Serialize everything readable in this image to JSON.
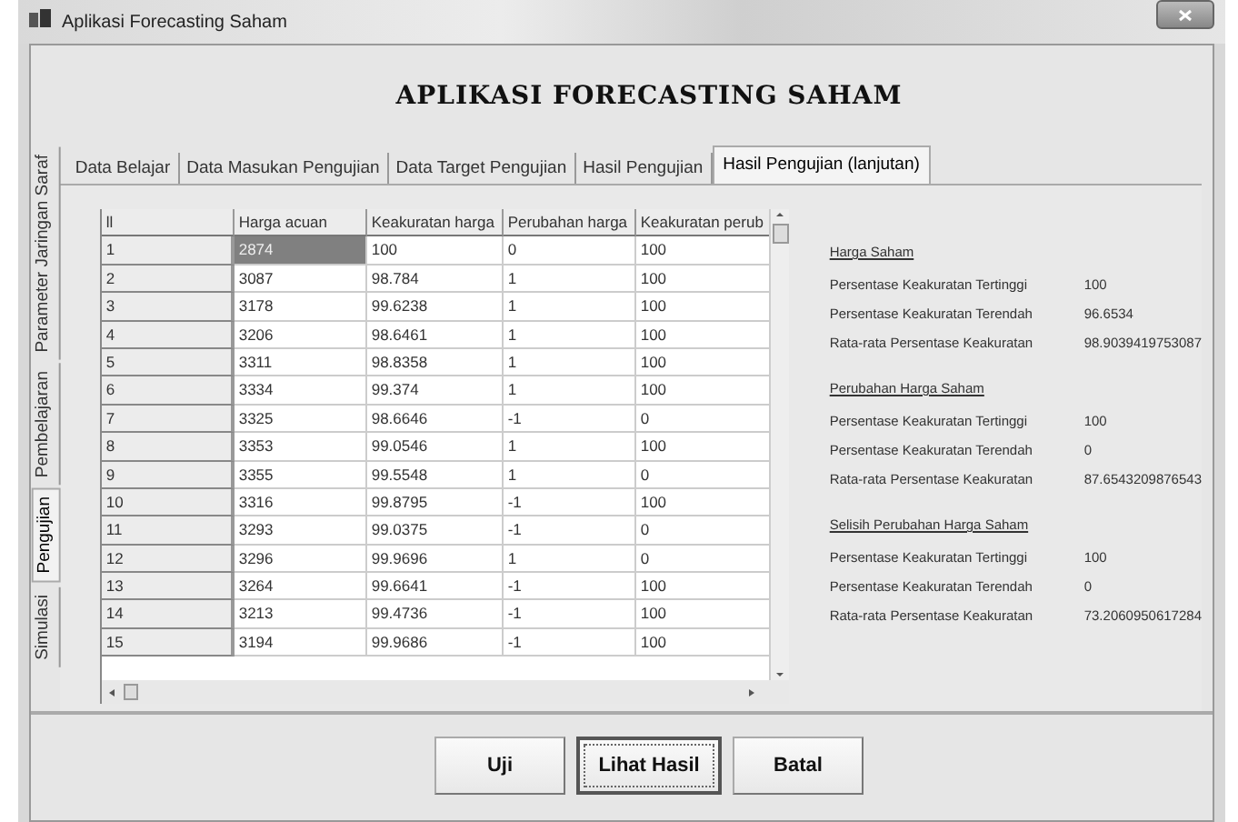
{
  "window": {
    "title": "Aplikasi Forecasting Saham"
  },
  "header": {
    "title": "APLIKASI FORECASTING SAHAM"
  },
  "side_tabs": [
    {
      "label": "Parameter Jaringan Saraf",
      "selected": false
    },
    {
      "label": "Pembelajaran",
      "selected": false
    },
    {
      "label": "Pengujian",
      "selected": true
    },
    {
      "label": "Simulasi",
      "selected": false
    }
  ],
  "tabs": [
    {
      "label": "Data Belajar",
      "selected": false
    },
    {
      "label": "Data Masukan Pengujian",
      "selected": false
    },
    {
      "label": "Data Target Pengujian",
      "selected": false
    },
    {
      "label": "Hasil Pengujian",
      "selected": false
    },
    {
      "label": "Hasil Pengujian (lanjutan)",
      "selected": true
    }
  ],
  "table": {
    "columns": [
      "ll",
      "Harga acuan",
      "Keakuratan harga",
      "Perubahan harga",
      "Keakuratan perub"
    ],
    "rows": [
      {
        "cells": [
          "1",
          "2874",
          "100",
          "0",
          "100"
        ],
        "selected": true
      },
      {
        "cells": [
          "2",
          "3087",
          "98.784",
          "1",
          "100"
        ],
        "selected": false
      },
      {
        "cells": [
          "3",
          "3178",
          "99.6238",
          "1",
          "100"
        ],
        "selected": false
      },
      {
        "cells": [
          "4",
          "3206",
          "98.6461",
          "1",
          "100"
        ],
        "selected": false
      },
      {
        "cells": [
          "5",
          "3311",
          "98.8358",
          "1",
          "100"
        ],
        "selected": false
      },
      {
        "cells": [
          "6",
          "3334",
          "99.374",
          "1",
          "100"
        ],
        "selected": false
      },
      {
        "cells": [
          "7",
          "3325",
          "98.6646",
          "-1",
          "0"
        ],
        "selected": false
      },
      {
        "cells": [
          "8",
          "3353",
          "99.0546",
          "1",
          "100"
        ],
        "selected": false
      },
      {
        "cells": [
          "9",
          "3355",
          "99.5548",
          "1",
          "0"
        ],
        "selected": false
      },
      {
        "cells": [
          "10",
          "3316",
          "99.8795",
          "-1",
          "100"
        ],
        "selected": false
      },
      {
        "cells": [
          "11",
          "3293",
          "99.0375",
          "-1",
          "0"
        ],
        "selected": false
      },
      {
        "cells": [
          "12",
          "3296",
          "99.9696",
          "1",
          "0"
        ],
        "selected": false
      },
      {
        "cells": [
          "13",
          "3264",
          "99.6641",
          "-1",
          "100"
        ],
        "selected": false
      },
      {
        "cells": [
          "14",
          "3213",
          "99.4736",
          "-1",
          "100"
        ],
        "selected": false
      },
      {
        "cells": [
          "15",
          "3194",
          "99.9686",
          "-1",
          "100"
        ],
        "selected": false
      }
    ]
  },
  "summary": [
    {
      "title": "Harga Saham",
      "rows": [
        {
          "label": "Persentase Keakuratan Tertinggi",
          "value": "100"
        },
        {
          "label": "Persentase Keakuratan Terendah",
          "value": "96.6534"
        },
        {
          "label": "Rata-rata Persentase Keakuratan",
          "value": "98.9039419753087"
        }
      ]
    },
    {
      "title": "Perubahan Harga Saham",
      "rows": [
        {
          "label": "Persentase Keakuratan Tertinggi",
          "value": "100"
        },
        {
          "label": "Persentase Keakuratan Terendah",
          "value": "0"
        },
        {
          "label": "Rata-rata Persentase Keakuratan",
          "value": "87.6543209876543"
        }
      ]
    },
    {
      "title": "Selisih Perubahan Harga Saham",
      "rows": [
        {
          "label": "Persentase Keakuratan Tertinggi",
          "value": "100"
        },
        {
          "label": "Persentase Keakuratan Terendah",
          "value": "0"
        },
        {
          "label": "Rata-rata Persentase Keakuratan",
          "value": "73.2060950617284"
        }
      ]
    }
  ],
  "buttons": [
    {
      "label": "Uji",
      "focused": false
    },
    {
      "label": "Lihat Hasil",
      "focused": true
    },
    {
      "label": "Batal",
      "focused": false
    }
  ]
}
